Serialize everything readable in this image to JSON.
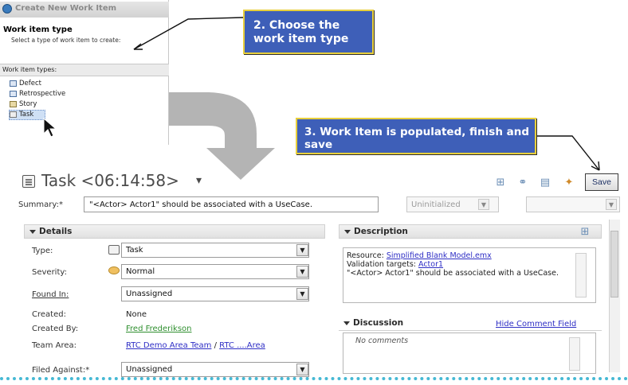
{
  "wizard": {
    "window_title": "Create New Work Item",
    "heading": "Work item type",
    "subheading": "Select a type of work item to create:",
    "types_label": "Work item types:",
    "types": [
      "Defect",
      "Retrospective",
      "Story",
      "Task"
    ],
    "selected": "Task"
  },
  "callouts": {
    "step2": "2. Choose the work item type",
    "step3": "3. Work Item is populated, finish and save"
  },
  "editor": {
    "title": "Task <06:14:58>",
    "save_label": "Save",
    "summary_label": "Summary:*",
    "summary_value": "\"<Actor> Actor1\" should be associated with a UseCase.",
    "state_value": "Uninitialized",
    "resolution_value": ""
  },
  "details": {
    "heading": "Details",
    "fields": {
      "type_label": "Type:",
      "type_value": "Task",
      "severity_label": "Severity:",
      "severity_value": "Normal",
      "found_in_label": "Found In:",
      "found_in_value": "Unassigned",
      "created_label": "Created:",
      "created_value": "None",
      "created_by_label": "Created By:",
      "created_by_value": "Fred Frederikson",
      "team_area_label": "Team Area:",
      "team_area_value_1": "RTC Demo Area Team",
      "team_area_sep": "/",
      "team_area_value_2": "RTC ....Area",
      "filed_against_label": "Filed Against:*",
      "filed_against_value": "Unassigned"
    }
  },
  "description": {
    "heading": "Description",
    "resource_label": "Resource:",
    "resource_link": "Simplified Blank Model.emx",
    "validation_label": "Validation targets:",
    "validation_link": "Actor1",
    "text": "\"<Actor> Actor1\" should be associated with a UseCase."
  },
  "discussion": {
    "heading": "Discussion",
    "hide_link": "Hide Comment Field",
    "empty_text": "No comments"
  },
  "colors": {
    "callout_bg": "#3e5fb8",
    "callout_border": "#e8cf3c",
    "link": "#2e2ec5",
    "dotted_rule": "#46b9d4"
  }
}
